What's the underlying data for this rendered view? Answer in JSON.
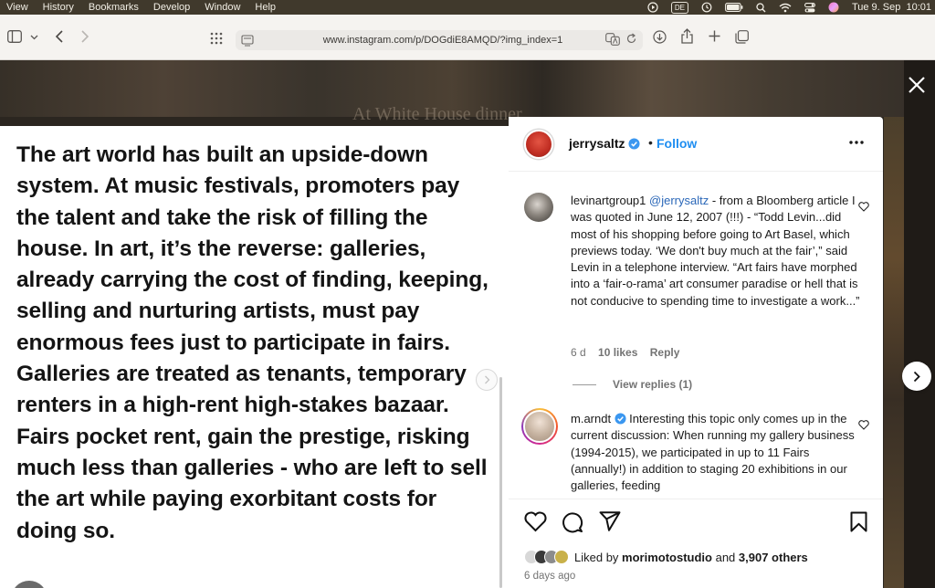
{
  "menubar": {
    "items": [
      "View",
      "History",
      "Bookmarks",
      "Develop",
      "Window",
      "Help"
    ],
    "input_source": "DE",
    "datetime": "Tue 9. Sep  10:01"
  },
  "browser": {
    "url": "www.instagram.com/p/DOGdiE8AMQD/?img_index=1"
  },
  "background": {
    "headline": "At White House dinner"
  },
  "post_image": {
    "text": "The art world has built an upside-down system. At music festivals, promoters pay the talent and take the risk of filling the house. In art, it’s the reverse: galleries, already carrying the cost of finding, keeping, selling and nurturing artists, must pay enormous fees just to participate in fairs. Galleries are treated as tenants, temporary renters in a high-rent high-stakes bazaar. Fairs pocket rent, gain the prestige, risking much less than galleries - who are left to sell the art while paying exorbitant costs for doing so."
  },
  "post_header": {
    "username": "jerrysaltz",
    "separator": "•",
    "follow_label": "Follow"
  },
  "comments": [
    {
      "username": "levinartgroup1",
      "mention": "@jerrysaltz",
      "text": " - from a Bloomberg article I was quoted in June 12, 2007 (!!!) - “Todd Levin...did most of his shopping before going to Art Basel, which previews today. ‘We don't buy much at the fair’,” said Levin in a telephone interview. “Art fairs have morphed into a ‘fair-o-rama’ art consumer paradise or hell that is not conducive to spending time to investigate a work...”",
      "age": "6 d",
      "likes": "10 likes",
      "reply_label": "Reply",
      "view_replies": "View replies (1)"
    },
    {
      "username": "m.arndt",
      "text": "Interesting this topic only comes up in the current discussion: When running my gallery business (1994-2015), we participated in up to 11 Fairs (annually!) in addition to staging 20 exhibitions in our galleries, feeding"
    }
  ],
  "likes": {
    "prefix": "Liked by ",
    "first_liker": "morimotostudio",
    "connector": " and ",
    "others": "3,907 others"
  },
  "post_date": "6 days ago",
  "colors": {
    "accent_blue": "#1f8ef1",
    "mention_blue": "#2a67b8",
    "muted_text": "#737373",
    "menubar_bg": "#40392c"
  }
}
